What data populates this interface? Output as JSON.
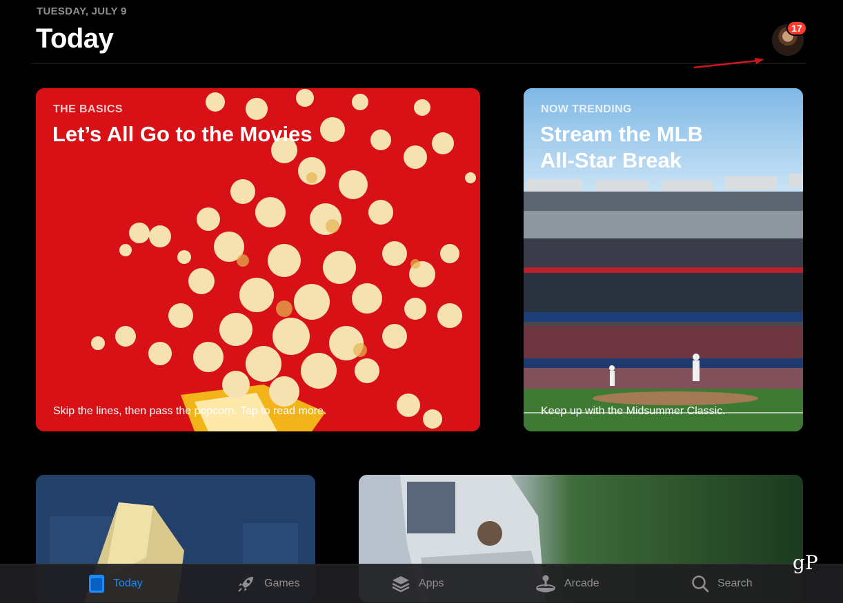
{
  "header": {
    "date": "TUESDAY, JULY 9",
    "title": "Today",
    "notification_count": "17"
  },
  "cards": [
    {
      "eyebrow": "THE BASICS",
      "headline": "Let’s All Go to the Movies",
      "caption": "Skip the lines, then pass the popcorn. Tap to read more."
    },
    {
      "eyebrow": "NOW TRENDING",
      "headline_line1": "Stream the MLB",
      "headline_line2": "All-Star Break",
      "caption": "Keep up with the Midsummer Classic."
    }
  ],
  "tabs": [
    {
      "label": "Today",
      "icon": "today-icon",
      "active": true
    },
    {
      "label": "Games",
      "icon": "rocket-icon",
      "active": false
    },
    {
      "label": "Apps",
      "icon": "layers-icon",
      "active": false
    },
    {
      "label": "Arcade",
      "icon": "joystick-icon",
      "active": false
    },
    {
      "label": "Search",
      "icon": "search-icon",
      "active": false
    }
  ],
  "watermark": "gP",
  "colors": {
    "accent": "#1a8cff",
    "badge": "#ff3b30",
    "movies_card": "#d71116",
    "annotation_arrow": "#d0161c"
  }
}
